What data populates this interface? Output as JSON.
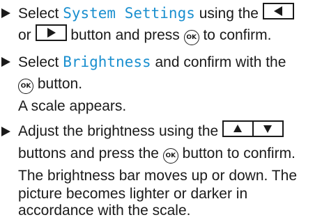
{
  "steps": [
    {
      "l1": {
        "a": "Select ",
        "hl": "System Settings",
        "b": " using the "
      },
      "l2": {
        "a": "or ",
        "b": " button and press ",
        "c": " to confirm."
      }
    },
    {
      "l1": {
        "a": "Select ",
        "hl": "Brightness",
        "b": " and confirm with the"
      },
      "l2": {
        "b": " button."
      },
      "l3": "A scale appears."
    },
    {
      "l1": {
        "a": "Adjust the brightness using the "
      },
      "l2": {
        "a": "buttons and press the ",
        "b": " button to confirm."
      },
      "l3": "The brightness bar moves up or down. The",
      "l4": "picture becomes lighter or darker in",
      "l5": "accordance with the scale."
    }
  ],
  "ok_label": "OK",
  "icons": {
    "bullet": "triangle-right",
    "left_button": "triangle-left",
    "right_button": "triangle-right",
    "up_button": "triangle-up",
    "down_button": "triangle-down",
    "ok_button": "ok-circle"
  }
}
